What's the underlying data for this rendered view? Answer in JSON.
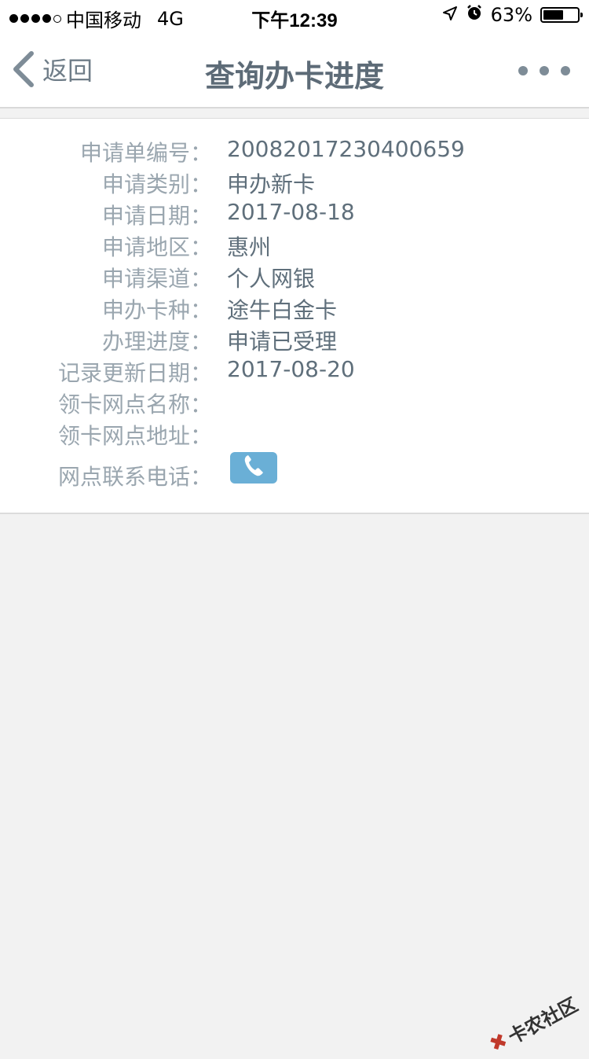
{
  "status_bar": {
    "carrier": "中国移动",
    "network": "4G",
    "time": "下午12:39",
    "battery_text": "63%",
    "battery_level": 0.63
  },
  "nav": {
    "back_label": "返回",
    "title": "查询办卡进度"
  },
  "details": [
    {
      "label": "申请单编号：",
      "value": "20082017230400659"
    },
    {
      "label": "申请类别：",
      "value": "申办新卡"
    },
    {
      "label": "申请日期：",
      "value": "2017-08-18"
    },
    {
      "label": "申请地区：",
      "value": "惠州"
    },
    {
      "label": "申请渠道：",
      "value": "个人网银"
    },
    {
      "label": "申办卡种：",
      "value": "途牛白金卡"
    },
    {
      "label": "办理进度：",
      "value": "申请已受理"
    },
    {
      "label": "记录更新日期：",
      "value": "2017-08-20"
    },
    {
      "label": "领卡网点名称：",
      "value": ""
    },
    {
      "label": "领卡网点地址：",
      "value": ""
    }
  ],
  "contact": {
    "label": "网点联系电话：",
    "icon": "phone-icon"
  },
  "watermark": "卡农社区",
  "colors": {
    "accent_button": "#6aafd6",
    "label_text": "#9aa6af",
    "value_text": "#5f6f7b"
  }
}
